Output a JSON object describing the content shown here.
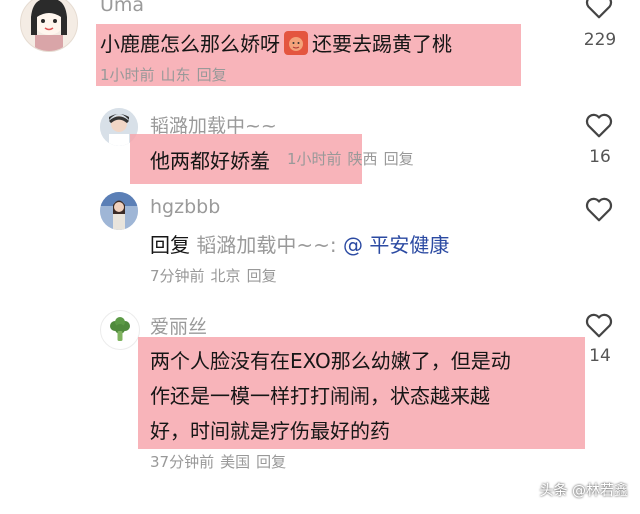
{
  "comments": [
    {
      "username": "Uma",
      "content_before_icon": "小鹿鹿怎么那么娇呀",
      "content_after_icon": "还要去踢黄了桃",
      "time": "1小时前",
      "location": "山东",
      "reply_label": "回复",
      "likes": "229"
    },
    {
      "username": "韬潞加载中~~",
      "content": "他两都好娇羞",
      "time": "1小时前",
      "location": "陕西",
      "reply_label": "回复",
      "likes": "16"
    },
    {
      "username": "hgzbbb",
      "reply_prefix": "回复",
      "reply_target": "韬潞加载中~~:",
      "mention": "@ 平安健康",
      "time": "7分钟前",
      "location": "北京",
      "reply_label": "回复",
      "likes": ""
    },
    {
      "username": "爱丽丝",
      "content_lines": [
        "两个人脸没有在EXO那么幼嫩了，但是动",
        "作还是一模一样打打闹闹，状态越来越",
        "好，时间就是疗伤最好的药"
      ],
      "time": "37分钟前",
      "location": "美国",
      "reply_label": "回复",
      "likes": "14"
    }
  ],
  "watermark": "头条 @林若鑫",
  "colors": {
    "highlight": "#f6a3ab",
    "mention": "#2b4aa2",
    "meta": "#999999"
  },
  "icons": [
    "avatar-uma",
    "avatar-taolu",
    "avatar-hgzbbb",
    "avatar-alice",
    "heart-icon",
    "emoji-icon"
  ]
}
